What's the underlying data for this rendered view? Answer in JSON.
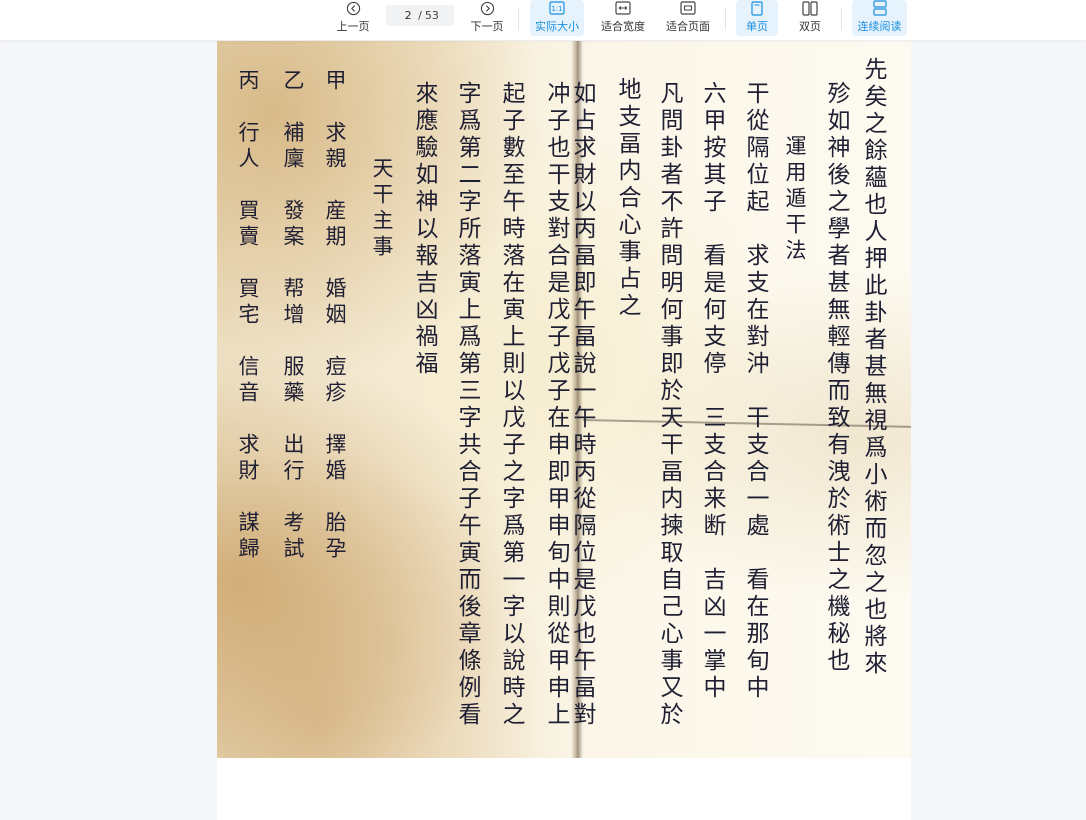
{
  "toolbar": {
    "prev_label": "上一页",
    "next_label": "下一页",
    "current_page": "2",
    "page_separator": "/",
    "total_pages": "53",
    "actual_size_label": "实际大小",
    "fit_width_label": "适合宽度",
    "fit_page_label": "适合页面",
    "single_page_label": "单页",
    "double_page_label": "双页",
    "continuous_label": "连续阅读",
    "accent_color": "#1a8fe0",
    "icons": {
      "prev": "chevron-left-circle-icon",
      "next": "chevron-right-circle-icon",
      "actual_size": "actual-size-icon",
      "fit_width": "fit-width-icon",
      "fit_page": "fit-page-icon",
      "single_page": "single-page-icon",
      "double_page": "double-page-icon",
      "continuous": "continuous-read-icon"
    }
  },
  "document": {
    "right_page": {
      "lines": [
        "先矣之餘蘊也人押此卦者甚無視爲小術而忽之也將來",
        "殄如神後之學者甚無輕傳而致有洩於術士之機秘也",
        "運用遁干法",
        "干從隔位起　求支在對沖　干支合一處　看在那旬中",
        "六甲按其子　看是何支停　三支合来断　吉凶一掌中",
        "凡問卦者不許問明何事即於天干畐内揀取自己心事又於",
        "地支畐内合心事占之"
      ]
    },
    "left_page": {
      "lines": [
        "如占求財以丙畐即午畐說一午時丙從隔位是戊也午畐對",
        "冲子也干支對合是戊子戊子在申即甲申旬中則從甲申上",
        "起子數至午時落在寅上則以戊子之字爲第一字以說時之",
        "字爲第二字所落寅上爲第三字共合子午寅而後章條例看",
        "來應驗如神以報吉凶禍福",
        "天干主事",
        "甲　求親　産期　婚姻　痘疹　擇婚　胎孕",
        "乙　補廩　發案　帮增　服藥　出行　考試",
        "丙　行人　買賣　買宅　信音　求財　謀歸"
      ]
    }
  }
}
